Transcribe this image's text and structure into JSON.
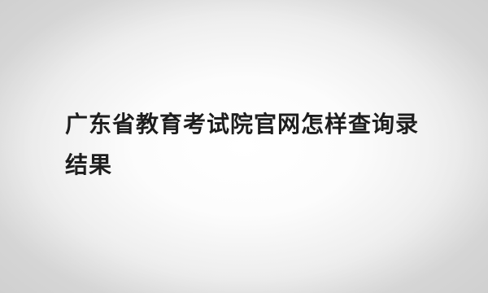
{
  "article": {
    "title": "广东省教育考试院官网怎样查询录结果"
  }
}
